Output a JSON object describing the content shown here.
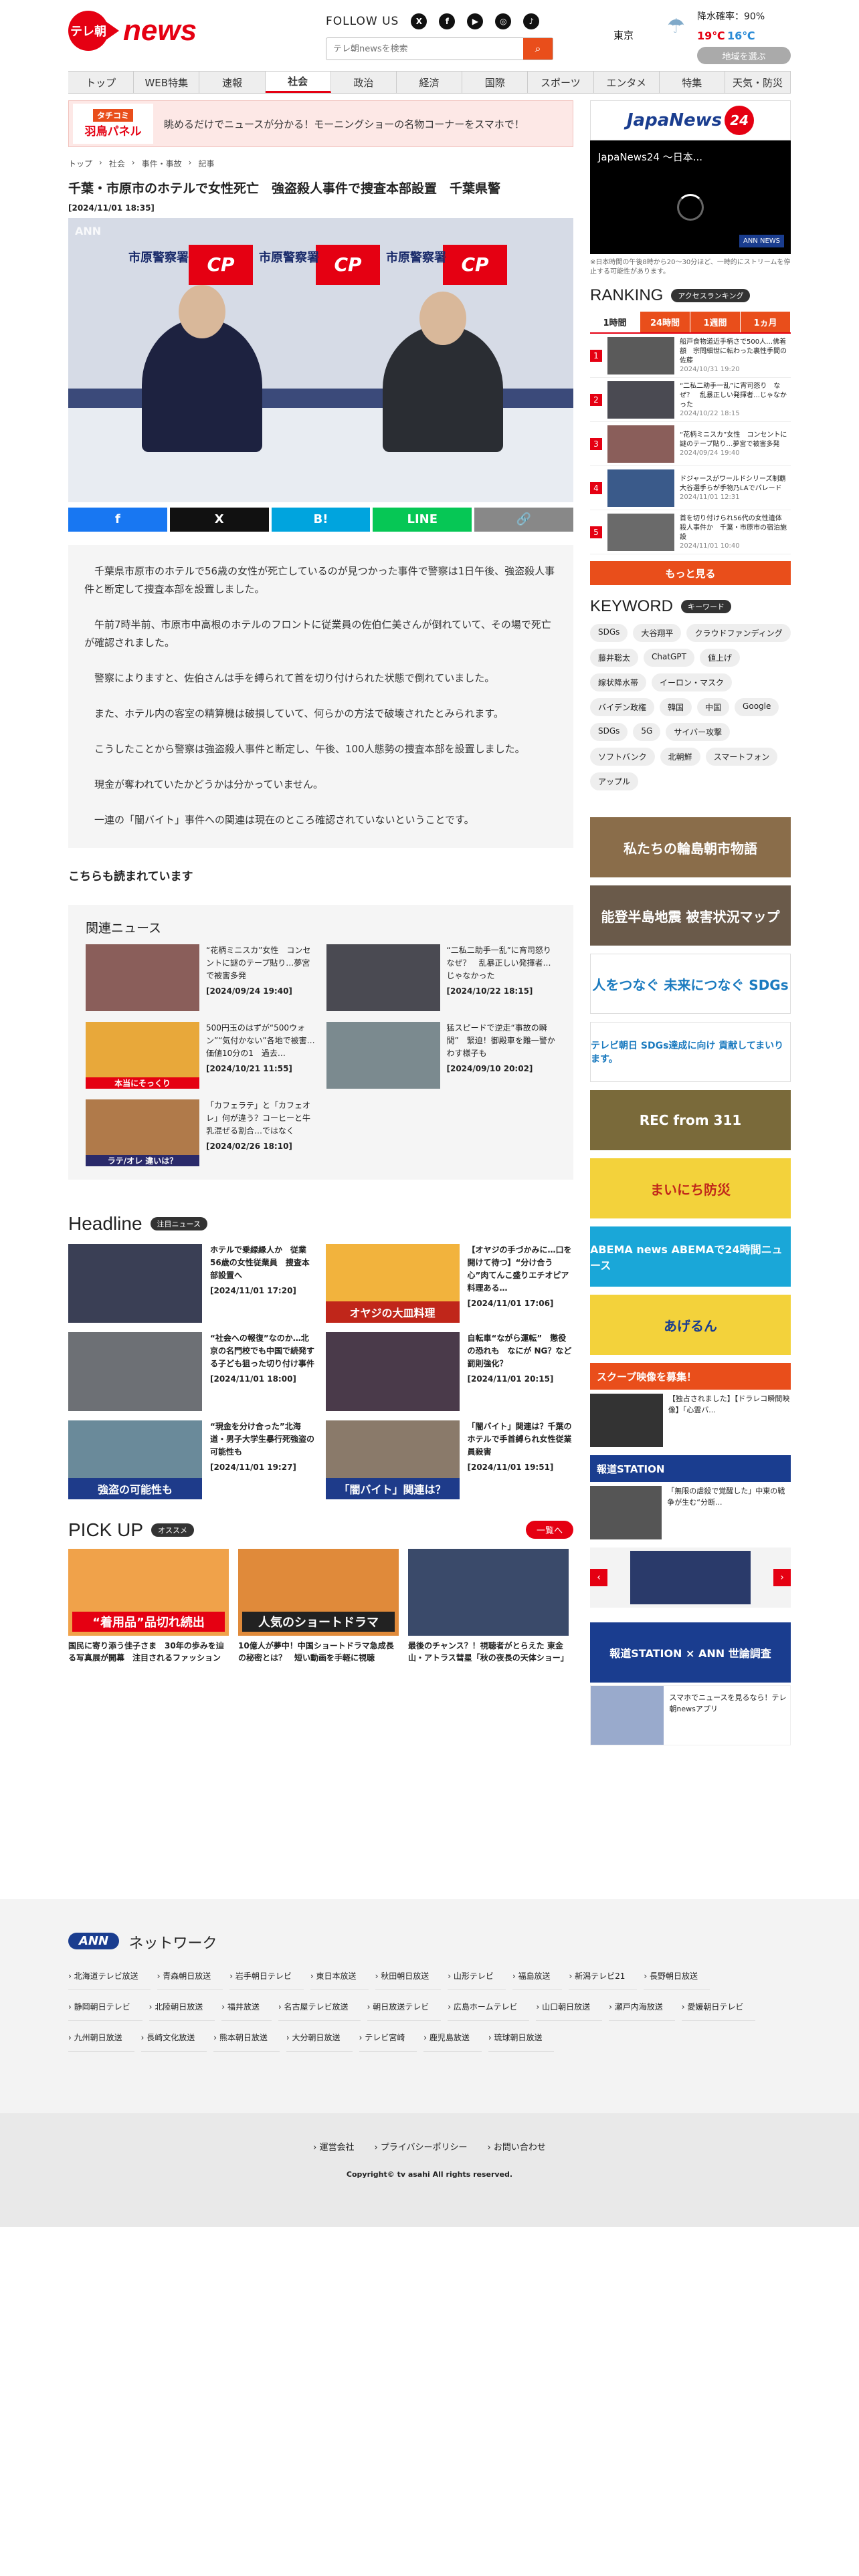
{
  "header": {
    "logo_text": "テレ朝",
    "logo_news": "news",
    "follow_label": "FOLLOW US",
    "social": [
      "x-icon",
      "facebook-icon",
      "youtube-icon",
      "instagram-icon",
      "tiktok-icon"
    ],
    "search_placeholder": "テレ朝newsを検索",
    "weather": {
      "city": "東京",
      "rain": "降水確率：90%",
      "hi": "19℃",
      "lo": "16℃",
      "area_button": "地域を選ぶ"
    }
  },
  "nav": [
    "トップ",
    "WEB特集",
    "速報",
    "社会",
    "政治",
    "経済",
    "国際",
    "スポーツ",
    "エンタメ",
    "特集",
    "天気・防災"
  ],
  "banner": {
    "label_top": "タチコミ",
    "label_main": "羽鳥パネル",
    "text": "眺めるだけでニュースが分かる！モーニングショーの名物コーナーをスマホで！"
  },
  "breadcrumb": [
    "トップ",
    "社会",
    "事件・事故",
    "記事"
  ],
  "article": {
    "title": "千葉・市原市のホテルで女性死亡　強盗殺人事件で捜査本部設置　千葉県警",
    "date": "[2024/11/01 18:35]",
    "photo_label": "ANN",
    "wall_text": "市原警察署",
    "paragraphs": [
      "千葉県市原市のホテルで56歳の女性が死亡しているのが見つかった事件で警察は1日午後、強盗殺人事件と断定して捜査本部を設置しました。",
      "午前7時半前、市原市中高根のホテルのフロントに従業員の佐伯仁美さんが倒れていて、その場で死亡が確認されました。",
      "警察によりますと、佐伯さんは手を縛られて首を切り付けられた状態で倒れていました。",
      "また、ホテル内の客室の精算機は破損していて、何らかの方法で破壊されたとみられます。",
      "こうしたことから警察は強盗殺人事件と断定し、午後、100人態勢の捜査本部を設置しました。",
      "現金が奪われていたかどうかは分かっていません。",
      "一連の「闇バイト」事件への関連は現在のところ確認されていないということです。"
    ]
  },
  "share": [
    "f",
    "X",
    "B!",
    "LINE",
    "link"
  ],
  "also_read": "こちらも読まれています",
  "related": {
    "title": "関連ニュース",
    "items": [
      {
        "text": "“花柄ミニスカ”女性　コンセントに謎のテープ貼り…夢宮で被害多発",
        "date": "[2024/09/24 19:40]"
      },
      {
        "text": "“二私二助手一乱”に宵司怒り　なぜ？　乱暴正しい発揮者…じゃなかった",
        "date": "[2024/10/22 18:15]"
      },
      {
        "text": "500円玉のはずが“500ウォン”“気付かない”各地で被害…価値10分の1　過去…",
        "date": "[2024/10/21 11:55]"
      },
      {
        "text": "猛スピードで逆走“事故の瞬間”　緊迫！御殿車を難一警かわす様子も",
        "date": "[2024/09/10 20:02]"
      },
      {
        "text": "「カフェラテ」と「カフェオレ」何が違う？コーヒーと牛乳混ぜる割合…ではなく",
        "date": "[2024/02/26 18:10]"
      }
    ],
    "thumb_caption": [
      "",
      "",
      "本当にそっくり",
      "",
      "ラテ/オレ 違いは？"
    ]
  },
  "headline": {
    "title": "Headline",
    "badge": "注目ニュース",
    "items": [
      {
        "text": "ホテルで乗緑縁人か　従業56歳の女性従業員　捜査本部設置へ",
        "date": "[2024/11/01 17:20]",
        "cap": ""
      },
      {
        "text": "【オヤジの手づかみに…口を開けて待つ】“分け合う心”肉てんこ盛りエチオピア料理ある…",
        "date": "[2024/11/01 17:06]",
        "cap": "オヤジの大皿料理"
      },
      {
        "text": "“社会への報復”なのか…北京の名門校でも中国で続発する子ども狙った切り付け事件",
        "date": "[2024/11/01 18:00]",
        "cap": ""
      },
      {
        "text": "自転車“ながら運転”　懲役の恐れも　なにが NG？など罰則強化？",
        "date": "[2024/11/01 20:15]",
        "cap": ""
      },
      {
        "text": "“現金を分け合った”北海道・男子大学生暴行死強盗の可能性も",
        "date": "[2024/11/01 19:27]",
        "cap": "強盗の可能性も"
      },
      {
        "text": "「闇バイト」関連は？千葉のホテルで手首縛られ女性従業員殺害",
        "date": "[2024/11/01 19:51]",
        "cap": "「闇バイト」関連は？"
      }
    ]
  },
  "pickup": {
    "title": "PICK UP",
    "badge": "オススメ",
    "list_button": "一覧へ",
    "items": [
      {
        "cap": "“着用品”品切れ続出",
        "text": "国民に寄り添う佳子さま　30年の歩みを辿る写真展が開幕　注目されるファッション"
      },
      {
        "cap": "人気のショートドラマ",
        "text": "10億人が夢中！中国ショートドラマ急成長の秘密とは？　短い動画を手軽に視聴"
      },
      {
        "cap": "",
        "text": "最後のチャンス？！視聴者がとらえた 東金山・アトラス彗星「秋の夜長の天体ショー」"
      }
    ]
  },
  "side": {
    "jn_label": "JapaNews",
    "jn_num": "24",
    "video_title": "JapaNews24 ～日本...",
    "video_badge": "ANN NEWS",
    "video_note": "※日本時間の午後8時から20〜30分ほど、一時的にストリームを停止する可能性があります。",
    "ranking_title": "RANKING",
    "ranking_badge": "アクセスランキング",
    "tabs": [
      "1時間",
      "24時間",
      "1週間",
      "1ヵ月"
    ],
    "ranking": [
      {
        "n": "1",
        "text": "船戸食物道近手柄さで500人…佛着額　宗問細世に転わった裏性手間の佐藤",
        "date": "2024/10/31 19:20"
      },
      {
        "n": "2",
        "text": "“二私二助手一乱”に宵司怒り　なぜ？　乱暴正しい発揮者…じゃなかった",
        "date": "2024/10/22 18:15"
      },
      {
        "n": "3",
        "text": "“花柄ミニスカ”女性　コンセントに謎のテープ貼り…夢宮で被害多発",
        "date": "2024/09/24 19:40"
      },
      {
        "n": "4",
        "text": "ドジャースがワールドシリーズ制覇　大谷選手らが手物乃LAでパレード",
        "date": "2024/11/01 12:31"
      },
      {
        "n": "5",
        "text": "首を切り付けられ56代の女性遺体　殺人事件か　千葉・市原市の宿泊施設",
        "date": "2024/11/01 10:40"
      }
    ],
    "more_button": "もっと見る",
    "keyword_title": "KEYWORD",
    "keyword_badge": "キーワード",
    "keywords": [
      "SDGs",
      "大谷翔平",
      "クラウドファンディング",
      "藤井聡太",
      "ChatGPT",
      "値上げ",
      "線状降水帯",
      "イーロン・マスク",
      "バイデン政権",
      "韓国",
      "中国",
      "Google",
      "SDGs",
      "5G",
      "サイバー攻撃",
      "ソフトバンク",
      "北朝鮮",
      "スマートフォン",
      "アップル"
    ],
    "banners": [
      {
        "text": "私たちの輪島朝市物語",
        "color": "#8a6d4a"
      },
      {
        "text": "能登半島地震 被害状況マップ",
        "color": "#6a5a4a"
      },
      {
        "text": "人をつなぐ 未来につなぐ SDGs",
        "color": "#ffffff"
      },
      {
        "text": "テレビ朝日 SDGs達成に向け 貢献してまいります。",
        "color": "#ffffff"
      },
      {
        "text": "REC from 311",
        "color": "#7a6a3a"
      },
      {
        "text": "まいにち防災",
        "color": "#f3d23b"
      },
      {
        "text": "ABEMA news ABEMAで24時間ニュース",
        "color": "#1aa7d8"
      },
      {
        "text": "あげるん",
        "color": "#f3d23b"
      },
      {
        "text": "スクープ映像を募集！",
        "color": "#e94e1b"
      },
      {
        "text": "報道STATION",
        "color": "#1a3d8f"
      },
      {
        "text": "報道STATION × ANN 世論調査",
        "color": "#1a3d8f"
      }
    ],
    "scoop_text": "【独占されました】【ドラレコ瞬間映像】「心霊バ...",
    "station_text": "「無限の虐殺で覚醒した」中東の戦争が生む“分断...",
    "app_text": "スマホでニュースを見るなら！テレ朝newsアプリ"
  },
  "network": {
    "badge": "ANN",
    "title": "ネットワーク",
    "stations": [
      "北海道テレビ放送",
      "青森朝日放送",
      "岩手朝日テレビ",
      "東日本放送",
      "秋田朝日放送",
      "山形テレビ",
      "福島放送",
      "新潟テレビ21",
      "長野朝日放送",
      "静岡朝日テレビ",
      "北陸朝日放送",
      "福井放送",
      "名古屋テレビ放送",
      "朝日放送テレビ",
      "広島ホームテレビ",
      "山口朝日放送",
      "瀬戸内海放送",
      "愛媛朝日テレビ",
      "九州朝日放送",
      "長崎文化放送",
      "熊本朝日放送",
      "大分朝日放送",
      "テレビ宮崎",
      "鹿児島放送",
      "琉球朝日放送"
    ]
  },
  "footer": {
    "links": [
      "運営会社",
      "プライバシーポリシー",
      "お問い合わせ"
    ],
    "copyright": "Copyright© tv asahi All rights reserved."
  }
}
